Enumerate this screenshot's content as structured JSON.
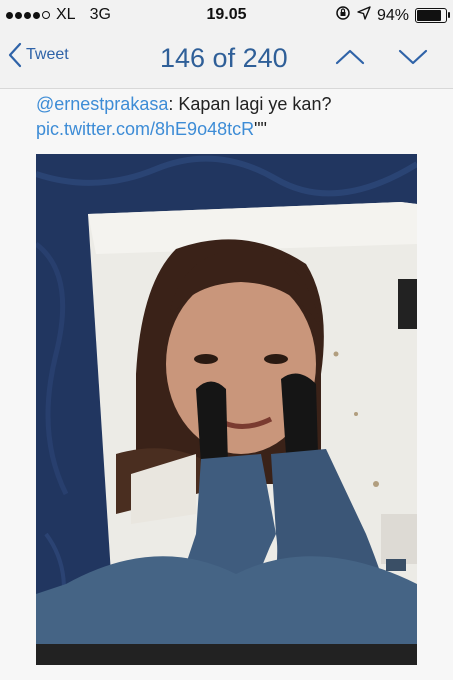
{
  "status_bar": {
    "carrier": "XL",
    "network": "3G",
    "time": "19.05",
    "battery": "94%",
    "battery_level": 0.94
  },
  "nav": {
    "back_label": "Tweet",
    "counter": "146 of 240"
  },
  "tweet": {
    "mention": "@ernestprakasa",
    "text": ": Kapan lagi ye kan?",
    "link": "pic.twitter.com/8hE9o48tcR",
    "trailing": "\"\""
  },
  "colors": {
    "accent": "#2f63a8",
    "link": "#3d8cd6"
  }
}
